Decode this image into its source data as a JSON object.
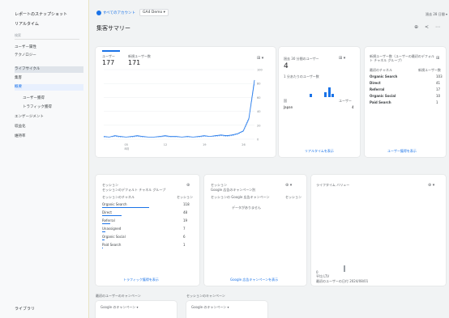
{
  "sidebar": {
    "title": "レポートのスナップショット",
    "subtitle": "リアルタイム",
    "search_placeholder": "検索",
    "items": [
      {
        "label": "ユーザー属性"
      },
      {
        "label": "テクノロジー"
      },
      {
        "label": "ライフサイクル"
      },
      {
        "label": "集客"
      },
      {
        "label": "概要"
      },
      {
        "label": "ユーザー獲得"
      },
      {
        "label": "トラフィック獲得"
      },
      {
        "label": "エンゲージメント"
      },
      {
        "label": "収益化"
      },
      {
        "label": "維持率"
      }
    ],
    "footer": "ライブラリ"
  },
  "topbar": {
    "property": "すべてのアカウント",
    "selector": "GA4 Demo ▾",
    "right_text": "過去 28 日間 ▾"
  },
  "page": {
    "title": "集客サマリー",
    "icons": "⊕ < ⋯"
  },
  "card_main": {
    "metric1_label": "ユーザー",
    "metric1_value": "177",
    "metric2_label": "新規ユーザー数",
    "metric2_value": "171",
    "y_ticks": [
      "100",
      "80",
      "60",
      "40",
      "20",
      "0"
    ],
    "x_ticks": [
      "05",
      "12",
      "19",
      "26"
    ],
    "x_sub": "8月"
  },
  "card_realtime": {
    "title": "過去 30 分間のユーザー",
    "value": "4",
    "sub": "1 分あたりのユーザー数",
    "col1": "国",
    "col2": "ユーザー",
    "row1": "Japan",
    "row1_val": "4",
    "link": "リアルタイムを表示"
  },
  "card_source": {
    "title": "新規ユーザー数（ユーザーの最初のデフォルト チャネル グループ）",
    "col1": "最初のチャネル",
    "col2": "新規ユーザー数",
    "rows": [
      {
        "name": "Organic Search",
        "val": "103"
      },
      {
        "name": "Direct",
        "val": "41"
      },
      {
        "name": "Referral",
        "val": "17"
      },
      {
        "name": "Organic Social",
        "val": "10"
      },
      {
        "name": "Paid Search",
        "val": "1"
      }
    ],
    "link": "ユーザー獲得を表示"
  },
  "card_sessions": {
    "title": "セッション",
    "subtitle": "セッションのデフォルト チャネル グループ",
    "col1": "セッションのチャネル",
    "col2": "セッション",
    "rows": [
      {
        "name": "Organic Search",
        "val": "118",
        "pct": 0.6
      },
      {
        "name": "Direct",
        "val": "48",
        "pct": 0.25
      },
      {
        "name": "Referral",
        "val": "19",
        "pct": 0.1
      },
      {
        "name": "Unassigned",
        "val": "7",
        "pct": 0.04
      },
      {
        "name": "Organic Social",
        "val": "6",
        "pct": 0.03
      },
      {
        "name": "Paid Search",
        "val": "1",
        "pct": 0.01
      }
    ],
    "link": "トラフィック獲得を表示"
  },
  "card_ads": {
    "title": "セッション",
    "subtitle": "Google 広告のキャンペーン別",
    "col1": "セッションの Google 広告キャンペーン",
    "col2": "セッション",
    "empty": "データがありません",
    "link": "Google 広告キャンペーンを表示"
  },
  "card_ltv": {
    "title": "ライフタイム バリュー",
    "axis_value": "0",
    "axis_label": "平均 LTV",
    "footer": "最初のユーザーの日付 ",
    "footer_value": "2024/08/01"
  },
  "bottom": {
    "left_label": "最初のユーザーのキャンペーン",
    "left_card": "Google のキャンペーン ▾",
    "right_label": "セッションのキャンペーン",
    "right_card": "Google のキャンペーン ▾"
  },
  "chart_data": {
    "type": "line",
    "title": "",
    "xlabel": "",
    "ylabel": "",
    "ylim": [
      0,
      100
    ],
    "x": [
      1,
      2,
      3,
      4,
      5,
      6,
      7,
      8,
      9,
      10,
      11,
      12,
      13,
      14,
      15,
      16,
      17,
      18,
      19,
      20,
      21,
      22,
      23,
      24,
      25,
      26,
      27,
      28
    ],
    "series": [
      {
        "values": [
          4,
          3,
          5,
          4,
          3,
          4,
          5,
          4,
          3,
          3,
          4,
          5,
          4,
          4,
          3,
          4,
          3,
          4,
          5,
          4,
          5,
          6,
          5,
          6,
          8,
          12,
          30,
          85
        ]
      },
      {
        "values": [
          3,
          3,
          4,
          3,
          3,
          3,
          4,
          3,
          3,
          3,
          3,
          4,
          3,
          3,
          3,
          3,
          3,
          3,
          4,
          4,
          4,
          5,
          4,
          5,
          7,
          11,
          28,
          80
        ]
      }
    ]
  }
}
